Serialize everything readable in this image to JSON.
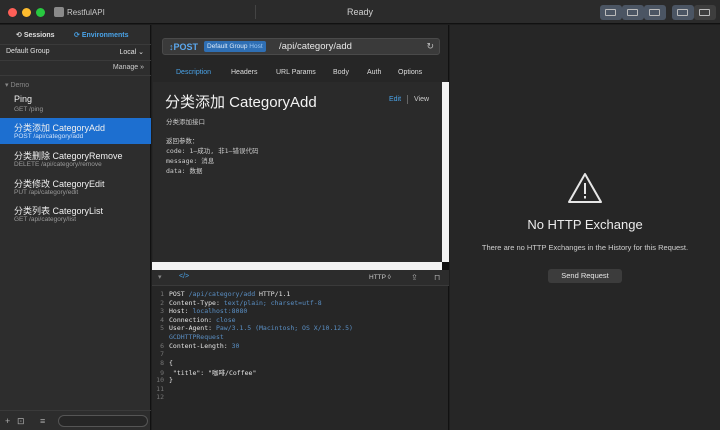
{
  "window": {
    "app_name": "RestfulAPI",
    "status": "Ready",
    "traffic_lights": [
      "#ff5f57",
      "#febc2e",
      "#28c840"
    ]
  },
  "sidebar": {
    "sessions_label": "Sessions",
    "environments_label": "Environments",
    "group_label": "Default Group",
    "env_select": "Local",
    "manage_label": "Manage »",
    "folder": "Demo",
    "requests": [
      {
        "name": "Ping",
        "path": "GET /ping"
      },
      {
        "name": "分类添加 CategoryAdd",
        "path": "POST /api/category/add"
      },
      {
        "name": "分类删除 CategoryRemove",
        "path": "DELETE /api/category/remove"
      },
      {
        "name": "分类修改 CategoryEdit",
        "path": "PUT /api/category/edit"
      },
      {
        "name": "分类列表 CategoryList",
        "path": "GET /api/category/list"
      }
    ]
  },
  "request": {
    "method": "POST",
    "env_group": "Default Group",
    "env_host": "Host",
    "url_path": "/api/category/add",
    "tabs": [
      "Description",
      "Headers",
      "URL Params",
      "Body",
      "Auth",
      "Options"
    ]
  },
  "description": {
    "title": "分类添加 CategoryAdd",
    "edit_label": "Edit",
    "view_label": "View",
    "subtitle": "分类添加接口",
    "lines": [
      "返回参数：",
      "code: 1—成功, 非1—错误代码",
      "message: 消息",
      "data: 数据"
    ]
  },
  "code_panel": {
    "tab_label": "</>",
    "format": "HTTP ◊",
    "lines": [
      {
        "n": "1",
        "parts": [
          {
            "t": "POST ",
            "c": "c-white"
          },
          {
            "t": "/api/category/add",
            "c": "c-blue"
          },
          {
            "t": " HTTP/1.1",
            "c": "c-white"
          }
        ]
      },
      {
        "n": "2",
        "parts": [
          {
            "t": "Content-Type: ",
            "c": "c-white"
          },
          {
            "t": "text/plain; charset=utf-8",
            "c": "c-blue"
          }
        ]
      },
      {
        "n": "3",
        "parts": [
          {
            "t": "Host: ",
            "c": "c-white"
          },
          {
            "t": "localhost:8080",
            "c": "c-blue"
          }
        ]
      },
      {
        "n": "4",
        "parts": [
          {
            "t": "Connection: ",
            "c": "c-white"
          },
          {
            "t": "close",
            "c": "c-blue"
          }
        ]
      },
      {
        "n": "5",
        "parts": [
          {
            "t": "User-Agent: ",
            "c": "c-white"
          },
          {
            "t": "Paw/3.1.5 (Macintosh; OS X/10.12.5)",
            "c": "c-blue"
          }
        ]
      },
      {
        "n": "",
        "parts": [
          {
            "t": "GCDHTTPRequest",
            "c": "c-blue"
          }
        ]
      },
      {
        "n": "6",
        "parts": [
          {
            "t": "Content-Length: ",
            "c": "c-white"
          },
          {
            "t": "30",
            "c": "c-blue"
          }
        ]
      },
      {
        "n": "7",
        "parts": []
      },
      {
        "n": "8",
        "parts": [
          {
            "t": "{",
            "c": "c-white"
          }
        ]
      },
      {
        "n": "9",
        "parts": [
          {
            "t": "  \"title\": ",
            "c": "c-white"
          },
          {
            "t": "\"咖啡/Coffee\"",
            "c": "c-white"
          }
        ]
      },
      {
        "n": "10",
        "parts": [
          {
            "t": "}",
            "c": "c-white"
          }
        ]
      },
      {
        "n": "11",
        "parts": []
      },
      {
        "n": "12",
        "parts": []
      }
    ]
  },
  "response": {
    "title": "No HTTP Exchange",
    "message": "There are no HTTP Exchanges in the History for this Request.",
    "button": "Send Request"
  }
}
